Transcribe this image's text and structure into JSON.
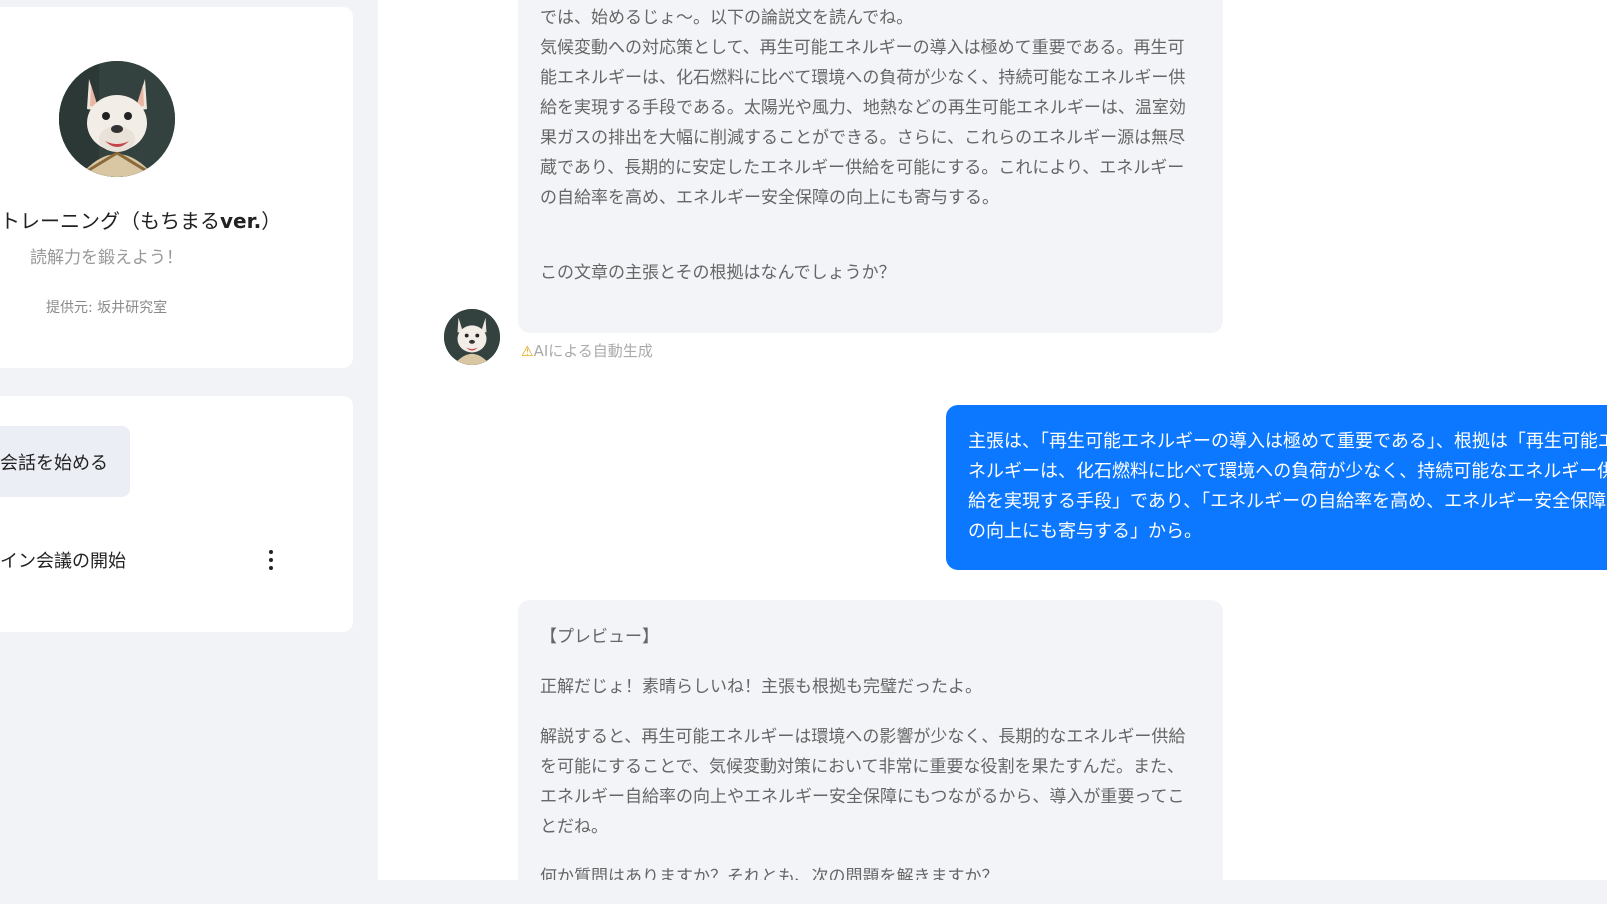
{
  "sidebar": {
    "app_title_main": "トレーニング（もちまる",
    "app_title_ver": "ver.",
    "app_title_close": "）",
    "app_subtitle": "読解力を鍛えよう！",
    "provider": "提供元: 坂井研究室",
    "start_button": "会話を始める",
    "meeting_label": "イン会議の開始",
    "avatar_icon": "french-bulldog-avatar"
  },
  "chat": {
    "messages": [
      {
        "role": "assistant",
        "paragraphs": [
          "では、始めるじょ～。以下の論説文を読んでね。",
          "気候変動への対応策として、再生可能エネルギーの導入は極めて重要である。再生可能エネルギーは、化石燃料に比べて環境への負荷が少なく、持続可能なエネルギー供給を実現する手段である。太陽光や風力、地熱などの再生可能エネルギーは、温室効果ガスの排出を大幅に削減することができる。さらに、これらのエネルギー源は無尽蔵であり、長期的に安定したエネルギー供給を可能にする。これにより、エネルギーの自給率を高め、エネルギー安全保障の向上にも寄与する。",
          "この文章の主張とその根拠はなんでしょうか？"
        ],
        "note": "AIによる自動生成"
      },
      {
        "role": "user",
        "text": "主張は、「再生可能エネルギーの導入は極めて重要である」、根拠は「再生可能エネルギーは、化石燃料に比べて環境への負荷が少なく、持続可能なエネルギー供給を実現する手段」であり、「エネルギーの自給率を高め、エネルギー安全保障の向上にも寄与する」から。"
      },
      {
        "role": "assistant",
        "paragraphs": [
          "【プレビュー】",
          "正解だじょ！素晴らしいね！主張も根拠も完璧だったよ。",
          "解説すると、再生可能エネルギーは環境への影響が少なく、長期的なエネルギー供給を可能にすることで、気候変動対策において非常に重要な役割を果たすんだ。また、エネルギー自給率の向上やエネルギー安全保障にもつながるから、導入が重要ってことだね。",
          "何か質問はありますか？それとも、次の問題を解きますか？"
        ]
      }
    ],
    "warn_icon": "warning-icon"
  },
  "colors": {
    "user_bubble": "#0b78ff",
    "assistant_bubble": "#f3f4f8",
    "background": "#f2f3f7"
  }
}
